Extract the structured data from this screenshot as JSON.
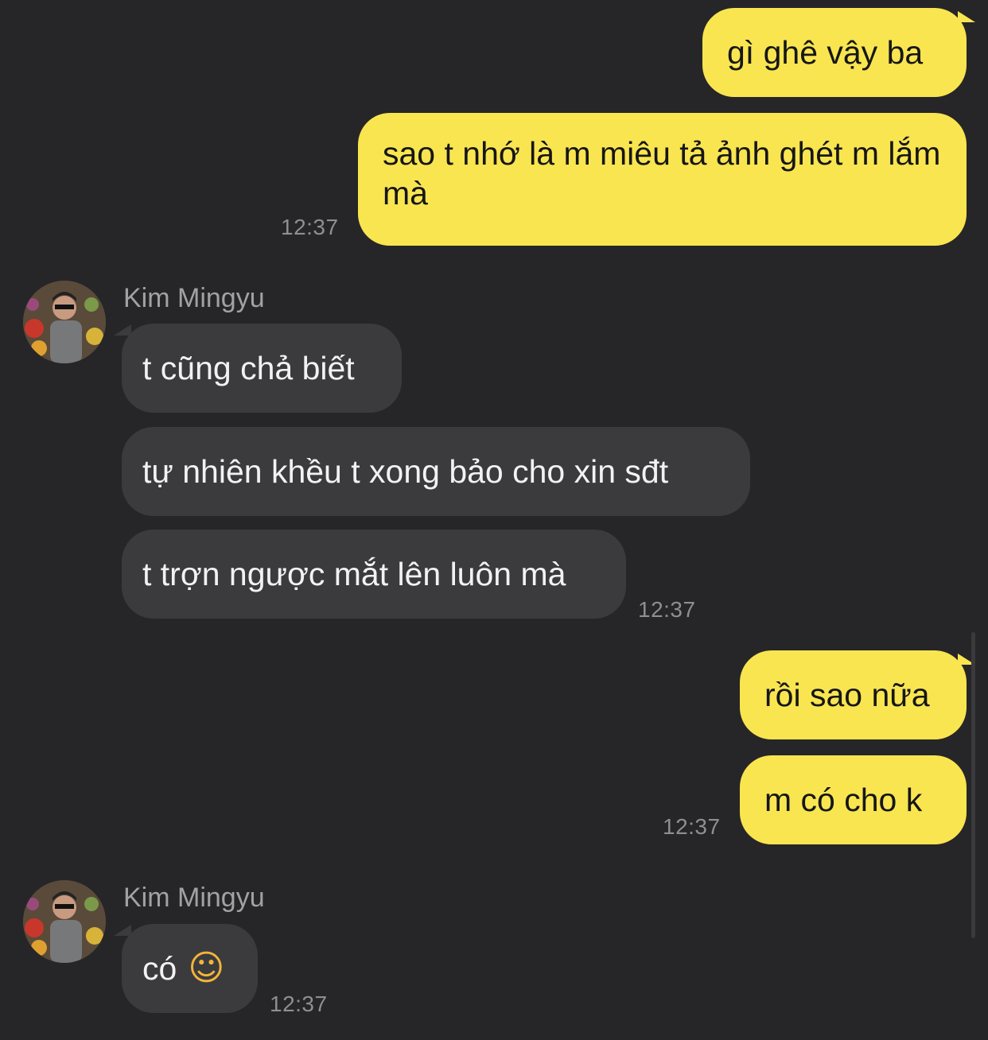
{
  "conversation": {
    "block1": {
      "messages": [
        "gì ghê vậy ba",
        "sao t nhớ là m miêu tả ảnh ghét m lắm mà"
      ],
      "time": "12:37"
    },
    "block2": {
      "sender": "Kim Mingyu",
      "messages": [
        "t cũng chả biết",
        "tự nhiên khều t xong bảo cho xin sđt",
        "t trợn ngược mắt lên luôn mà"
      ],
      "time": "12:37"
    },
    "block3": {
      "messages": [
        "rồi sao nữa",
        "m có cho k"
      ],
      "time": "12:37"
    },
    "block4": {
      "sender": "Kim Mingyu",
      "message": "có",
      "emoji": "☺",
      "emoji_name": "smiling-face-icon",
      "time": "12:37"
    }
  },
  "colors": {
    "background": "#262628",
    "outgoing_bubble": "#f9e550",
    "incoming_bubble": "#3b3b3d",
    "timestamp": "#8e8e93"
  }
}
